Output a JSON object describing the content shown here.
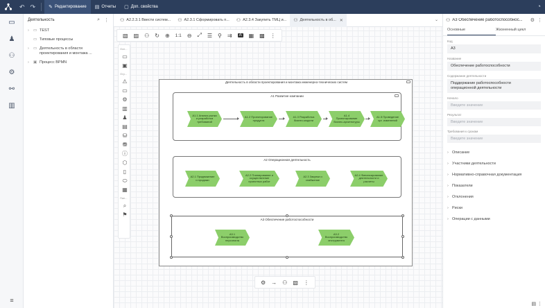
{
  "topbar": {
    "mode_edit": "Редактирование",
    "mode_reports": "Отчеты",
    "mode_props": "Доп. свойства"
  },
  "tree": {
    "title": "Деятельность",
    "nodes": [
      {
        "label": "TEST"
      },
      {
        "label": "Типовые процессы"
      },
      {
        "label": "Деятельность в области проектирования и монтажа ..."
      },
      {
        "label": "Процесс BPMN"
      }
    ]
  },
  "tabs": [
    {
      "label": "А2.2.3.1 Ввести систем..."
    },
    {
      "label": "А2.3.1 Сформировать п..."
    },
    {
      "label": "А2.3.4 Закупить ТМЦ и..."
    },
    {
      "label": "Деятельность в об..."
    }
  ],
  "toolbar": {
    "zoom_reset": "1:1"
  },
  "palette": {
    "sec1": "Оcн...",
    "sec2": "Огр...",
    "sec3": "Пан..."
  },
  "diagram": {
    "title": "Деятельность в области проектирования и монтажа инженерно-технических систем",
    "groups": [
      {
        "title": "А1 Развитие компании",
        "steps": [
          "А1.1 Анализ рынка и разработка требований",
          "А1.2 Проектирование продукта",
          "А1.3 Разработка бизнес-модели",
          "А1.4 Проектирование бизнес-архитектуры",
          "А1.5 Проведение орг. изменений"
        ]
      },
      {
        "title": "А2 Операционная деятельность",
        "steps": [
          "А2.1 Продвижение и продажи",
          "А2.2 Планирование и осуществление проектных работ",
          "А2.3 Закупки и снабжение",
          "А2.4 Финансирование деятельности и расчеты"
        ]
      },
      {
        "title": "А3 Обеспечение работоспособности",
        "steps": [
          "А3.1 Воспроизводство персонала",
          "А3.2 Воспроизводство инструмента"
        ]
      }
    ]
  },
  "props": {
    "header": "А3 Обеспечение работоспособнос...",
    "tab_main": "Основные",
    "tab_lifecycle": "Жизненный цикл",
    "fields": [
      {
        "label": "Код",
        "value": "А3",
        "placeholder": false
      },
      {
        "label": "Название",
        "value": "Обеспечение работоспособности",
        "placeholder": false
      },
      {
        "label": "Содержание деятельности",
        "value": "Поддержание работоспособности операционной деятельности",
        "placeholder": false
      },
      {
        "label": "Начало",
        "value": "Введите значение",
        "placeholder": true
      },
      {
        "label": "Результат",
        "value": "Введите значение",
        "placeholder": true
      },
      {
        "label": "Требования к срокам",
        "value": "Введите значение",
        "placeholder": true
      }
    ],
    "sections": [
      "Описание",
      "Участники деятельности",
      "Нормативно-справочная документация",
      "Показатели",
      "Отклонения",
      "Риски",
      "Операции с данными"
    ]
  },
  "colors": {
    "topbar": "#2c3e5c",
    "process_fill": "#8cce6a"
  }
}
